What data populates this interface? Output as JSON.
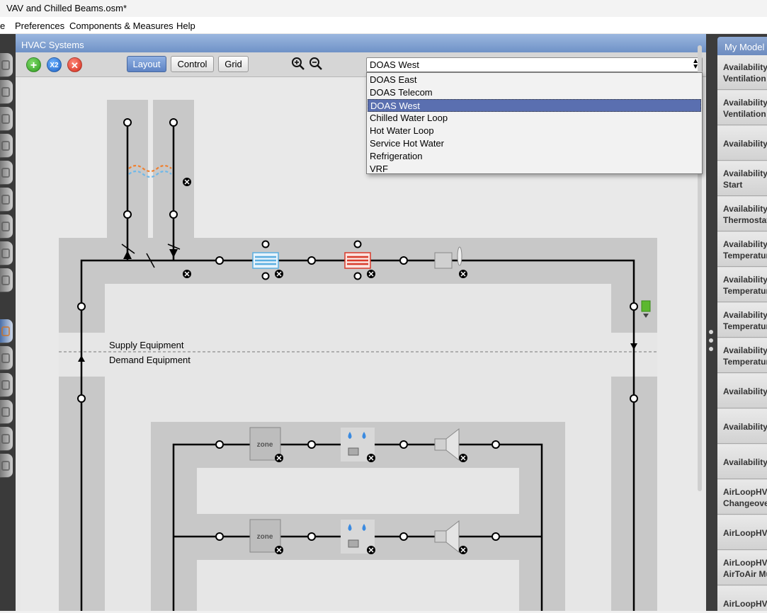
{
  "window": {
    "title": "VAV and Chilled Beams.osm*"
  },
  "menu": [
    "e",
    "Preferences",
    "Components & Measures",
    "Help"
  ],
  "panel": {
    "title": "HVAC Systems"
  },
  "toolbar": {
    "add_icon": "plus-icon",
    "duplicate_label": "X2",
    "remove_icon": "x-icon",
    "views": [
      "Layout",
      "Control",
      "Grid"
    ],
    "active_view": "Layout",
    "zoom_in_icon": "zoom-in-icon",
    "zoom_out_icon": "zoom-out-icon"
  },
  "system_select": {
    "selected": "DOAS West",
    "options": [
      "DOAS East",
      "DOAS Telecom",
      "DOAS West",
      "Chilled Water Loop",
      "Hot Water Loop",
      "Service Hot Water",
      "Refrigeration",
      "VRF"
    ]
  },
  "diagram": {
    "supply_label": "Supply Equipment",
    "demand_label": "Demand Equipment",
    "zone_label": "zone",
    "colors": {
      "cooling_coil": "#5aaee0",
      "heating_coil": "#d83a2a",
      "setpoint_manager": "#5cb82e",
      "pipe": "#000000",
      "loop_band": "#c8c8c8"
    }
  },
  "my_model": {
    "tab": "My Model",
    "items": [
      [
        "Availability",
        "Ventilation"
      ],
      [
        "Availability",
        "Ventilation"
      ],
      [
        "Availability"
      ],
      [
        "Availability",
        "Start"
      ],
      [
        "Availability",
        "Thermostat"
      ],
      [
        "Availability",
        "Temperature"
      ],
      [
        "Availability",
        "Temperature"
      ],
      [
        "Availability",
        "Temperature"
      ],
      [
        "Availability",
        "Temperature"
      ],
      [
        "Availability"
      ],
      [
        "Availability"
      ],
      [
        "Availability"
      ],
      [
        "AirLoopHVAC",
        "Changeover"
      ],
      [
        "AirLoopHVAC"
      ],
      [
        "AirLoopHVAC",
        "AirToAir Mu"
      ],
      [
        "AirLoopHVAC"
      ]
    ]
  }
}
